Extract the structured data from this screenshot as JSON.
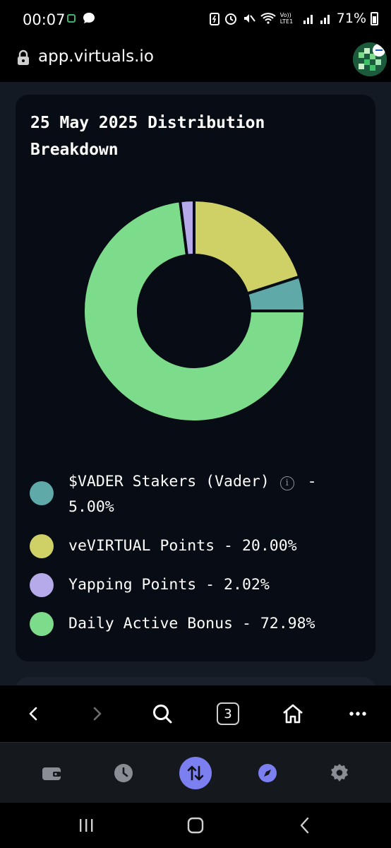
{
  "status_bar": {
    "time": "00:07",
    "network_label": "Vo)) LTE1",
    "battery_text": "71%"
  },
  "browser": {
    "url": "app.virtuals.io",
    "tab_count": "3"
  },
  "card": {
    "title": "25 May 2025 Distribution Breakdown"
  },
  "chart_data": {
    "type": "pie",
    "donut": true,
    "title": "25 May 2025 Distribution Breakdown",
    "categories": [
      "$VADER Stakers (Vader)",
      "veVIRTUAL Points",
      "Yapping Points",
      "Daily Active Bonus"
    ],
    "values": [
      5.0,
      20.0,
      2.02,
      72.98
    ],
    "unit": "%",
    "colors": [
      "#5fa9a8",
      "#cfd166",
      "#b6aaea",
      "#7ddc8b"
    ],
    "legend_position": "bottom"
  },
  "legend": {
    "items": [
      {
        "label": "$VADER Stakers (Vader)",
        "value_text": " - 5.00%",
        "color": "#5fa9a8",
        "has_info": true
      },
      {
        "label": "veVIRTUAL Points",
        "value_text": " - 20.00%",
        "color": "#cfd166"
      },
      {
        "label": "Yapping Points",
        "value_text": " - 2.02%",
        "color": "#b6aaea"
      },
      {
        "label": "Daily Active Bonus",
        "value_text": " - 72.98%",
        "color": "#7ddc8b"
      }
    ]
  },
  "nav_icons": [
    "back-icon",
    "forward-icon",
    "search-icon",
    "tabs-icon",
    "home-icon",
    "more-icon"
  ],
  "dock_icons": [
    "wallet-icon",
    "history-icon",
    "swap-icon",
    "explore-icon",
    "settings-icon"
  ],
  "accent_color": "#7b7ff0"
}
